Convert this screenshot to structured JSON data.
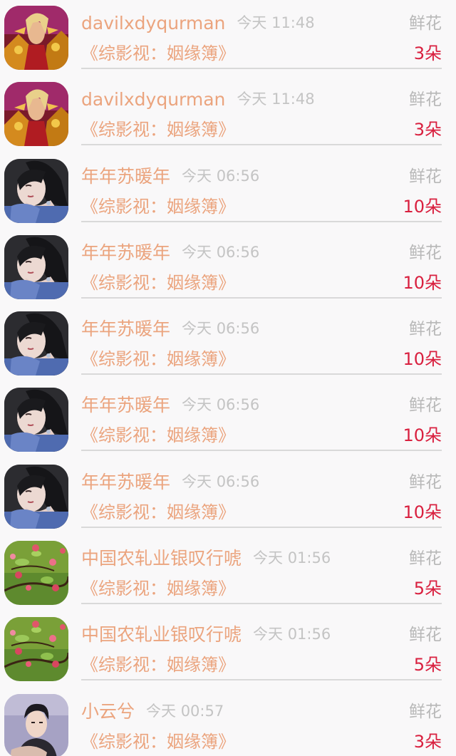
{
  "rows": [
    {
      "avatar": "warrior",
      "name": "davilxdyqurman",
      "time": "今天 11:48",
      "gift_label": "鲜花",
      "work": "《综影视：姻缘簿》",
      "count": "3朵"
    },
    {
      "avatar": "warrior",
      "name": "davilxdyqurman",
      "time": "今天 11:48",
      "gift_label": "鲜花",
      "work": "《综影视：姻缘簿》",
      "count": "3朵"
    },
    {
      "avatar": "woman",
      "name": "年年苏暖年",
      "time": "今天 06:56",
      "gift_label": "鲜花",
      "work": "《综影视：姻缘簿》",
      "count": "10朵"
    },
    {
      "avatar": "woman",
      "name": "年年苏暖年",
      "time": "今天 06:56",
      "gift_label": "鲜花",
      "work": "《综影视：姻缘簿》",
      "count": "10朵"
    },
    {
      "avatar": "woman",
      "name": "年年苏暖年",
      "time": "今天 06:56",
      "gift_label": "鲜花",
      "work": "《综影视：姻缘簿》",
      "count": "10朵"
    },
    {
      "avatar": "woman",
      "name": "年年苏暖年",
      "time": "今天 06:56",
      "gift_label": "鲜花",
      "work": "《综影视：姻缘簿》",
      "count": "10朵"
    },
    {
      "avatar": "woman",
      "name": "年年苏暖年",
      "time": "今天 06:56",
      "gift_label": "鲜花",
      "work": "《综影视：姻缘簿》",
      "count": "10朵"
    },
    {
      "avatar": "flowers",
      "name": "中国农轧业银叹行唬",
      "time": "今天 01:56",
      "gift_label": "鲜花",
      "work": "《综影视：姻缘簿》",
      "count": "5朵"
    },
    {
      "avatar": "flowers",
      "name": "中国农轧业银叹行唬",
      "time": "今天 01:56",
      "gift_label": "鲜花",
      "work": "《综影视：姻缘簿》",
      "count": "5朵"
    },
    {
      "avatar": "man",
      "name": "小云兮",
      "time": "今天 00:57",
      "gift_label": "鲜花",
      "work": "《综影视：姻缘簿》",
      "count": "3朵"
    }
  ]
}
